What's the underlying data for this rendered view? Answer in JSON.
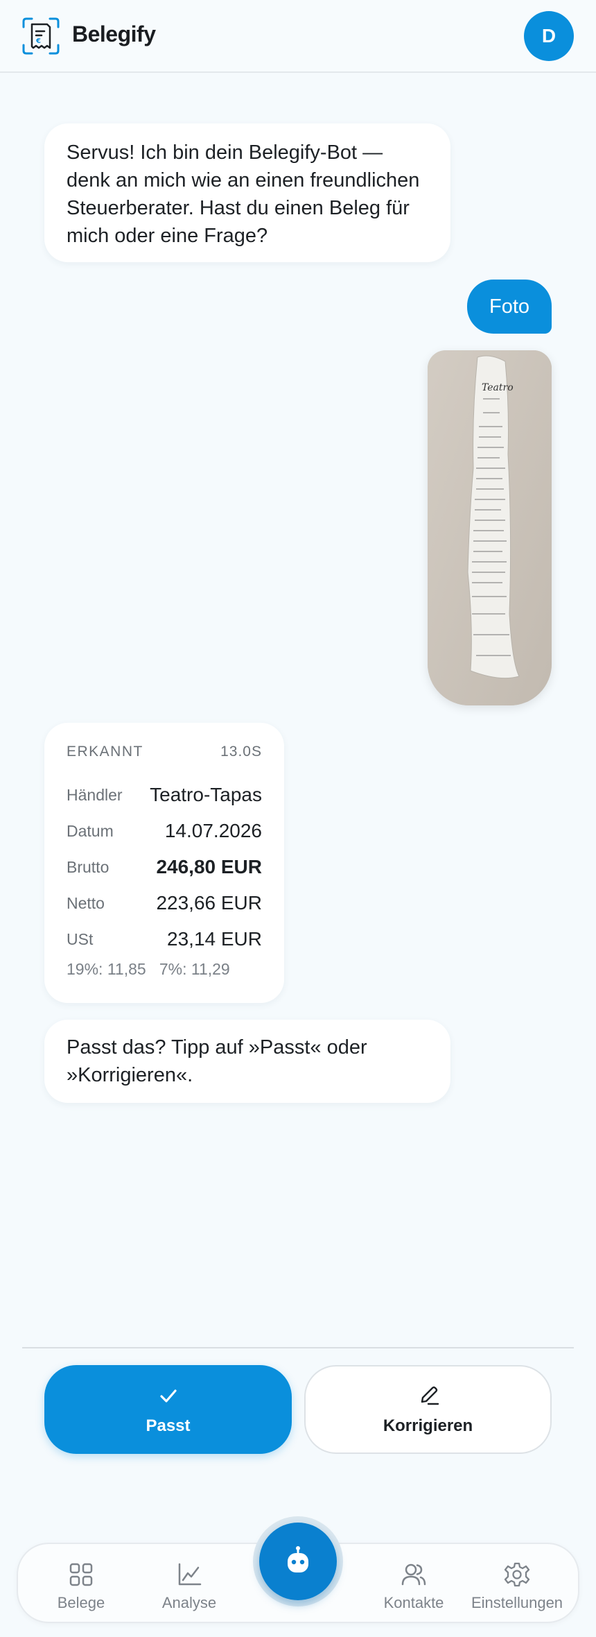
{
  "header": {
    "app_name": "Belegify",
    "avatar_initial": "D"
  },
  "chat": {
    "welcome": "Servus! Ich bin dein Belegify-Bot — denk an mich wie an einen freundlichen Steuerberater. Hast du einen Beleg für mich oder eine Frage?",
    "user_message": "Foto",
    "result_card": {
      "status": "ERKANNT",
      "duration": "13.0S",
      "rows": [
        {
          "label": "Händler",
          "value": "Teatro-Tapas"
        },
        {
          "label": "Datum",
          "value": "14.07.2026"
        },
        {
          "label": "Brutto",
          "value": "246,80 EUR"
        },
        {
          "label": "Netto",
          "value": "223,66 EUR"
        },
        {
          "label": "USt",
          "value": "23,14 EUR"
        }
      ],
      "vat_breakdown": "19%: 11,85   7%: 11,29"
    },
    "question": "Passt das? Tipp auf »Passt« oder »Korrigieren«."
  },
  "actions": {
    "confirm_label": "Passt",
    "correct_label": "Korrigieren"
  },
  "nav": {
    "items": [
      {
        "label": "Belege",
        "icon": "grid-icon"
      },
      {
        "label": "Analyse",
        "icon": "chart-icon"
      },
      {
        "label": "",
        "icon": "bot-icon"
      },
      {
        "label": "Kontakte",
        "icon": "users-icon"
      },
      {
        "label": "Einstellungen",
        "icon": "gear-icon"
      }
    ]
  },
  "colors": {
    "accent": "#0a8fdc",
    "background": "#f5fafd"
  }
}
